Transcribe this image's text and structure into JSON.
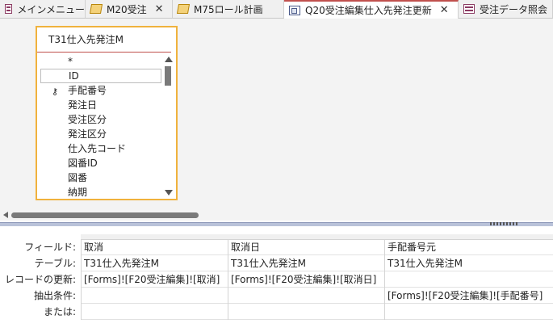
{
  "tabs": [
    {
      "label": "メインメニュー",
      "icon": "form-icon",
      "active": false,
      "closable": false
    },
    {
      "label": "M20受注",
      "icon": "macro-icon",
      "active": false,
      "closable": true
    },
    {
      "label": "M75ロール計画",
      "icon": "macro-icon",
      "active": false,
      "closable": false
    },
    {
      "label": "Q20受注編集仕入先発注更新",
      "icon": "query-icon",
      "active": true,
      "closable": true
    },
    {
      "label": "受注データ照会",
      "icon": "form-icon",
      "active": false,
      "closable": false
    }
  ],
  "close_glyph": "✕",
  "table": {
    "title": "T31仕入先発注M",
    "fields": [
      {
        "label": "*",
        "key": false,
        "selected": false
      },
      {
        "label": "ID",
        "key": false,
        "selected": true
      },
      {
        "label": "手配番号",
        "key": true,
        "selected": false
      },
      {
        "label": "発注日",
        "key": false,
        "selected": false
      },
      {
        "label": "受注区分",
        "key": false,
        "selected": false
      },
      {
        "label": "発注区分",
        "key": false,
        "selected": false
      },
      {
        "label": "仕入先コード",
        "key": false,
        "selected": false
      },
      {
        "label": "図番ID",
        "key": false,
        "selected": false
      },
      {
        "label": "図番",
        "key": false,
        "selected": false
      },
      {
        "label": "納期",
        "key": false,
        "selected": false
      }
    ]
  },
  "grid": {
    "row_labels": [
      "フィールド:",
      "テーブル:",
      "レコードの更新:",
      "抽出条件:",
      "または:"
    ],
    "columns": [
      {
        "cells": [
          "取消",
          "T31仕入先発注M",
          "[Forms]![F20受注編集]![取消]",
          "",
          ""
        ]
      },
      {
        "cells": [
          "取消日",
          "T31仕入先発注M",
          "[Forms]![F20受注編集]![取消日]",
          "",
          ""
        ]
      },
      {
        "cells": [
          "手配番号元",
          "T31仕入先発注M",
          "",
          "[Forms]![F20受注編集]![手配番号]",
          ""
        ]
      }
    ]
  }
}
